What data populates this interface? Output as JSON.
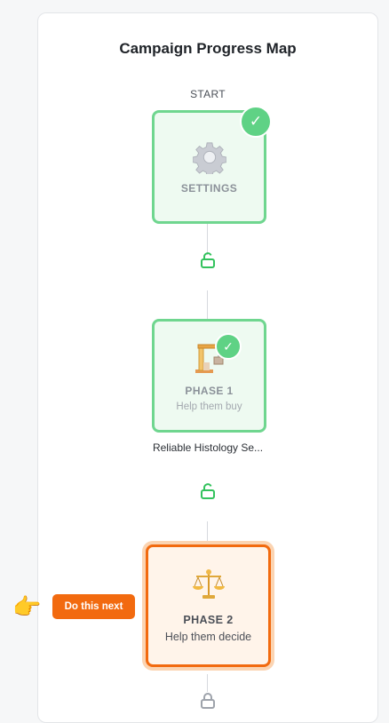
{
  "map": {
    "title": "Campaign Progress Map",
    "start_label": "START"
  },
  "steps": [
    {
      "title": "SETTINGS",
      "subtitle": "",
      "status": "completed",
      "icon": "gear-icon"
    },
    {
      "title": "PHASE 1",
      "subtitle": "Help them buy",
      "status": "completed",
      "icon": "crane-icon",
      "caption": "Reliable Histology Se..."
    },
    {
      "title": "PHASE 2",
      "subtitle": "Help them decide",
      "status": "current",
      "icon": "scales-icon"
    }
  ],
  "next_hint": {
    "label": "Do this next",
    "icon": "pointing-hand-icon"
  },
  "colors": {
    "completed_border": "#6fd68f",
    "current_border": "#f26a0f",
    "badge": "#f26a0f"
  }
}
